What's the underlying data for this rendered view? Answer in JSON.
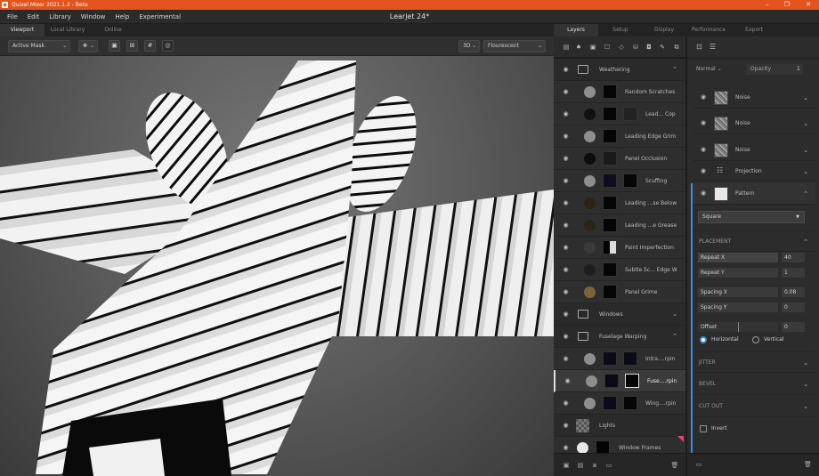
{
  "app": {
    "title": "Quixel Mixer 2021.1.2 - Beta",
    "document": "Learjet 24*",
    "colors": {
      "titlebar": "#e2541d",
      "accent": "#3a8fd6"
    }
  },
  "menu": [
    "File",
    "Edit",
    "Library",
    "Window",
    "Help",
    "Experimental"
  ],
  "viewport_tabs": [
    "Viewport",
    "Local Library",
    "Online"
  ],
  "viewport_toolbar": {
    "mask_mode": "Active Mask",
    "view_mode": "3D",
    "environment": "Flourescent"
  },
  "right_tabs": [
    "Layers",
    "Setup",
    "Display",
    "Performance",
    "Export"
  ],
  "layers": [
    {
      "name": "Weathering",
      "type": "group",
      "chevron": "⌃"
    },
    {
      "name": "Random Scratches",
      "circle": "#8e8e8e"
    },
    {
      "name": "Lead... Cop",
      "circle": "#111111"
    },
    {
      "name": "Leading Edge Grim",
      "circle": "#8e8e8e"
    },
    {
      "name": "Panel Occlusion",
      "circle": "#0c0c0c"
    },
    {
      "name": "Scuffing",
      "circle": "#8e8e8e"
    },
    {
      "name": "Leading ...se Below",
      "circle": "#2b2318"
    },
    {
      "name": "Leading ...e Grease",
      "circle": "#2a2419"
    },
    {
      "name": "Paint Imperfection",
      "circle": "#3a3a3a"
    },
    {
      "name": "Subtle Sc... Edge W",
      "circle": "#1e1e1e"
    },
    {
      "name": "Panel Grime",
      "circle": "#7d6438"
    },
    {
      "name": "Windows",
      "type": "group",
      "chevron": "⌄"
    },
    {
      "name": "Fuselage Warping",
      "type": "group",
      "chevron": "⌃"
    },
    {
      "name": "Intra....rpin",
      "circle": "#8e8e8e"
    },
    {
      "name": "Fuse....rpin",
      "circle": "#8e8e8e",
      "selected": true
    },
    {
      "name": "Wing....rpin",
      "circle": "#8e8e8e"
    },
    {
      "name": "Lights",
      "type": "special"
    },
    {
      "name": "Window Frames",
      "circle": "#e8e8e8"
    }
  ],
  "props": {
    "blend_mode": "Normal",
    "opacity_label": "Opacity",
    "opacity": "1",
    "modifiers": [
      "Noise",
      "Noise",
      "Noise",
      "Projection",
      "Pattern"
    ],
    "pattern_shape": "Square",
    "placement_label": "PLACEMENT",
    "repeat_x_label": "Repeat X",
    "repeat_x": "40",
    "repeat_y_label": "Repeat Y",
    "repeat_y": "1",
    "spacing_x_label": "Spacing X",
    "spacing_x": "0.08",
    "spacing_y_label": "Spacing Y",
    "spacing_y": "0",
    "offset_label": "Offset",
    "offset": "0",
    "horizontal_label": "Horizontal",
    "vertical_label": "Vertical",
    "jitter_label": "JITTER",
    "bevel_label": "BEVEL",
    "cutout_label": "CUT OUT",
    "invert_label": "Invert"
  }
}
